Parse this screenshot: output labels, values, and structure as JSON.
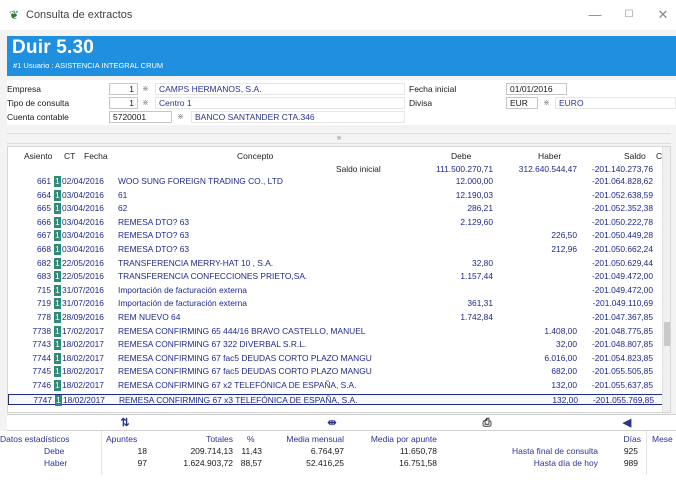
{
  "window": {
    "title": "Consulta de extractos",
    "minimize": "—",
    "maximize": "☐",
    "close": "✕"
  },
  "banner": {
    "app_name": "Duir 5.30",
    "user_line": "#1 Usuario : ASISTENCIA INTEGRAL CRUM",
    "color": "#1f8fe0"
  },
  "form": {
    "empresa": {
      "label": "Empresa",
      "code": "1",
      "name": "CAMPS HERMANOS, S.A."
    },
    "tipo": {
      "label": "Tipo de consulta",
      "code": "1",
      "name": "Centro 1"
    },
    "cuenta": {
      "label": "Cuenta contable",
      "code": "5720001",
      "name": "BANCO SANTANDER CTA.346"
    },
    "fecha_inicial": {
      "label": "Fecha inicial",
      "value": "01/01/2016"
    },
    "divisa": {
      "label": "Divisa",
      "code": "EUR",
      "name": "EURO"
    }
  },
  "grid": {
    "headers": {
      "asiento": "Asiento",
      "ct": "CT",
      "fecha": "Fecha",
      "concepto": "Concepto",
      "debe": "Debe",
      "haber": "Haber",
      "saldo": "Saldo",
      "c": "C"
    },
    "saldo_inicial": {
      "label": "Saldo inicial",
      "debe": "111.500.270,71",
      "haber": "312.640.544,47",
      "saldo": "-201.140.273,76"
    },
    "rows": [
      {
        "asiento": "661",
        "ct": "1",
        "fecha": "02/04/2016",
        "concepto": "WOO SUNG FOREIGN TRADING CO., LTD",
        "debe": "12.000,00",
        "haber": "",
        "saldo": "-201.064.828,62"
      },
      {
        "asiento": "664",
        "ct": "1",
        "fecha": "03/04/2016",
        "concepto": "61",
        "debe": "12.190,03",
        "haber": "",
        "saldo": "-201.052.638,59"
      },
      {
        "asiento": "665",
        "ct": "1",
        "fecha": "03/04/2016",
        "concepto": "62",
        "debe": "286,21",
        "haber": "",
        "saldo": "-201.052.352,38"
      },
      {
        "asiento": "666",
        "ct": "1",
        "fecha": "03/04/2016",
        "concepto": "REMESA DTO? 63",
        "debe": "2.129,60",
        "haber": "",
        "saldo": "-201.050.222,78"
      },
      {
        "asiento": "667",
        "ct": "1",
        "fecha": "03/04/2016",
        "concepto": "REMESA DTO? 63",
        "debe": "",
        "haber": "226,50",
        "saldo": "-201.050.449,28"
      },
      {
        "asiento": "668",
        "ct": "1",
        "fecha": "03/04/2016",
        "concepto": "REMESA DTO? 63",
        "debe": "",
        "haber": "212,96",
        "saldo": "-201.050.662,24"
      },
      {
        "asiento": "682",
        "ct": "1",
        "fecha": "22/05/2016",
        "concepto": "TRANSFERENCIA   MERRY-HAT 10 , S.A.",
        "debe": "32,80",
        "haber": "",
        "saldo": "-201.050.629,44"
      },
      {
        "asiento": "683",
        "ct": "1",
        "fecha": "22/05/2016",
        "concepto": "TRANSFERENCIA   CONFECCIONES PRIETO,SA.",
        "debe": "1.157,44",
        "haber": "",
        "saldo": "-201.049.472,00"
      },
      {
        "asiento": "715",
        "ct": "1",
        "fecha": "31/07/2016",
        "concepto": "Importación de facturación externa",
        "debe": "",
        "haber": "",
        "saldo": "-201.049.472,00"
      },
      {
        "asiento": "719",
        "ct": "1",
        "fecha": "31/07/2016",
        "concepto": "Importación de facturación externa",
        "debe": "361,31",
        "haber": "",
        "saldo": "-201.049.110,69"
      },
      {
        "asiento": "778",
        "ct": "1",
        "fecha": "28/09/2016",
        "concepto": "REM NUEVO 64",
        "debe": "1.742,84",
        "haber": "",
        "saldo": "-201.047.367,85"
      },
      {
        "asiento": "7738",
        "ct": "1",
        "fecha": "17/02/2017",
        "concepto": "REMESA CONFIRMING 65 444/16  BRAVO CASTELLO, MANUEL",
        "debe": "",
        "haber": "1.408,00",
        "saldo": "-201.048.775,85"
      },
      {
        "asiento": "7743",
        "ct": "1",
        "fecha": "18/02/2017",
        "concepto": "REMESA CONFIRMING 67 322  DIVERBAL S.R.L.",
        "debe": "",
        "haber": "32,00",
        "saldo": "-201.048.807,85"
      },
      {
        "asiento": "7744",
        "ct": "1",
        "fecha": "18/02/2017",
        "concepto": "REMESA CONFIRMING 67 fac5  DEUDAS CORTO PLAZO MANGU",
        "debe": "",
        "haber": "6.016,00",
        "saldo": "-201.054.823,85"
      },
      {
        "asiento": "7745",
        "ct": "1",
        "fecha": "18/02/2017",
        "concepto": "REMESA CONFIRMING 67 fac5  DEUDAS CORTO PLAZO MANGU",
        "debe": "",
        "haber": "682,00",
        "saldo": "-201.055.505,85"
      },
      {
        "asiento": "7746",
        "ct": "1",
        "fecha": "18/02/2017",
        "concepto": "REMESA CONFIRMING 67 x2  TELEFÓNICA DE ESPAÑA, S.A.",
        "debe": "",
        "haber": "132,00",
        "saldo": "-201.055.637,85"
      },
      {
        "asiento": "7747",
        "ct": "1",
        "fecha": "18/02/2017",
        "concepto": "REMESA CONFIRMING 67 x3  TELEFÓNICA DE ESPAÑA, S.A.",
        "debe": "",
        "haber": "132,00",
        "saldo": "-201.055.769,85"
      }
    ]
  },
  "stats": {
    "headers": {
      "title": "Datos estadísticos",
      "apuntes": "Apuntes",
      "totales": "Totales",
      "pct": "%",
      "media_mensual": "Media mensual",
      "media_apunte": "Media por apunte",
      "dias": "Días",
      "meses": "Mese"
    },
    "debe": {
      "label": "Debe",
      "apuntes": "18",
      "totales": "209.714,13",
      "pct": "11,43",
      "media_mensual": "6.764,97",
      "media_apunte": "11.650,78"
    },
    "haber": {
      "label": "Haber",
      "apuntes": "97",
      "totales": "1.624.903,72",
      "pct": "88,57",
      "media_mensual": "52.416,25",
      "media_apunte": "16.751,58"
    },
    "hasta_final": {
      "label": "Hasta final de consulta",
      "dias": "925"
    },
    "hasta_hoy": {
      "label": "Hasta día de hoy",
      "dias": "989"
    }
  },
  "colors": {
    "text_blue": "#1e2a8c",
    "ct_teal": "#2f8b78"
  }
}
